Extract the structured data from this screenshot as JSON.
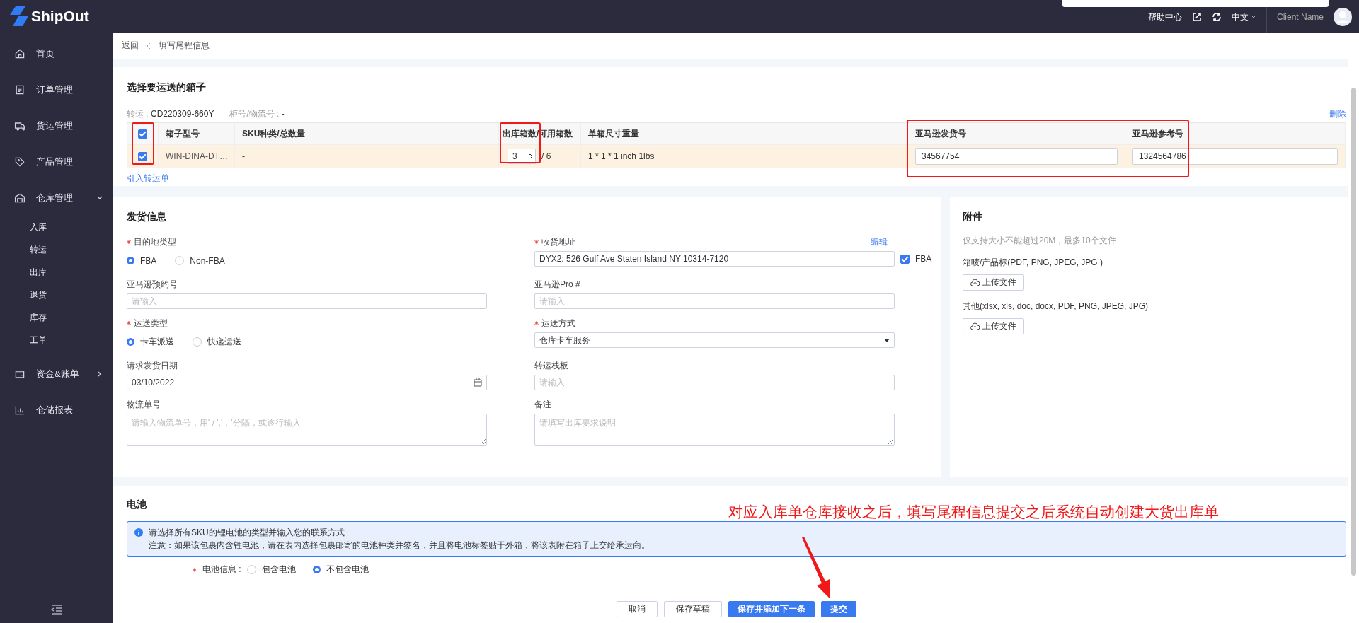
{
  "header": {
    "logo": "ShipOut",
    "help": "帮助中心",
    "language": "中文",
    "user": "Client Name"
  },
  "sidebar": {
    "items": [
      {
        "label": "首页"
      },
      {
        "label": "订单管理"
      },
      {
        "label": "货运管理"
      },
      {
        "label": "产品管理"
      },
      {
        "label": "仓库管理",
        "expanded": true,
        "children": [
          {
            "label": "入库"
          },
          {
            "label": "转运"
          },
          {
            "label": "出库"
          },
          {
            "label": "退货"
          },
          {
            "label": "库存"
          },
          {
            "label": "工单"
          }
        ]
      },
      {
        "label": "资金&账单",
        "expanded": false
      },
      {
        "label": "仓储报表"
      }
    ]
  },
  "breadcrumb": {
    "back": "返回",
    "current": "填写尾程信息"
  },
  "boxes": {
    "title": "选择要运送的箱子",
    "transfer_label": "转运 : ",
    "transfer_value": "CD220309-660Y",
    "container_label": "柜号/物流号 : ",
    "container_value": "-",
    "delete": "删除",
    "header_checked": true,
    "columns": [
      "箱子型号",
      "SKU种类/总数量",
      "出库箱数/可用箱数",
      "单箱尺寸重量",
      "亚马逊发货号",
      "亚马逊参考号"
    ],
    "rows": [
      {
        "checked": true,
        "box_type": "WIN-DINA-DT…",
        "sku": "-",
        "quantity": "3",
        "available": "/ 6",
        "size": "1 * 1 * 1 inch 1lbs",
        "shipment_id": "34567754",
        "reference_id": "1324564786"
      }
    ],
    "import_link": "引入转运单"
  },
  "shipping": {
    "title": "发货信息",
    "fields": [
      {
        "kind": "radio",
        "label": "目的地类型",
        "required": true,
        "options": [
          {
            "label": "FBA",
            "selected": true
          },
          {
            "label": "Non-FBA",
            "selected": false
          }
        ]
      },
      {
        "kind": "address",
        "label": "收货地址",
        "required": true,
        "action": "编辑",
        "value": "DYX2: 526 Gulf Ave Staten Island NY 10314-7120",
        "fba": {
          "label": "FBA",
          "checked": true
        }
      },
      {
        "kind": "input",
        "label": "亚马逊预约号",
        "required": false,
        "placeholder": "请输入"
      },
      {
        "kind": "input",
        "label": "亚马逊Pro #",
        "required": false,
        "placeholder": "请输入"
      },
      {
        "kind": "radio",
        "label": "运送类型",
        "required": true,
        "options": [
          {
            "label": "卡车派送",
            "selected": true
          },
          {
            "label": "快递运送",
            "selected": false
          }
        ]
      },
      {
        "kind": "select",
        "label": "运送方式",
        "required": true,
        "value": "仓库卡车服务"
      },
      {
        "kind": "date",
        "label": "请求发货日期",
        "required": false,
        "value": "03/10/2022"
      },
      {
        "kind": "input",
        "label": "转运栈板",
        "required": false,
        "placeholder": "请输入"
      },
      {
        "kind": "textarea",
        "label": "物流单号",
        "required": false,
        "placeholder": "请输入物流单号，用' / ','，'分隔，或逐行输入"
      },
      {
        "kind": "textarea",
        "label": "备注",
        "required": false,
        "placeholder": "请填写出库要求说明"
      }
    ]
  },
  "attachments": {
    "title": "附件",
    "hint": "仅支持大小不能超过20M，最多10个文件",
    "groups": [
      {
        "label": "箱唛/产品标(PDF, PNG, JPEG, JPG )",
        "button": "上传文件"
      },
      {
        "label": "其他(xlsx, xls, doc, docx, PDF, PNG, JPEG, JPG)",
        "button": "上传文件"
      }
    ]
  },
  "battery": {
    "title": "电池",
    "notice_title": "请选择所有SKU的锂电池的类型并输入您的联系方式",
    "notice_body": "注意：如果该包裹内含锂电池，请在表内选择包裹邮寄的电池种类并签名，并且将电池标签贴于外箱，将该表附在箱子上交给承运商。",
    "label": "电池信息 :",
    "required": true,
    "options": [
      {
        "label": "包含电池",
        "selected": false
      },
      {
        "label": "不包含电池",
        "selected": true
      }
    ]
  },
  "annotation": "对应入库单仓库接收之后，填写尾程信息提交之后系统自动创建大货出库单",
  "footer": {
    "buttons": [
      {
        "label": "取消",
        "kind": "default"
      },
      {
        "label": "保存草稿",
        "kind": "default"
      },
      {
        "label": "保存并添加下一条",
        "kind": "primary"
      },
      {
        "label": "提交",
        "kind": "primary"
      }
    ]
  }
}
